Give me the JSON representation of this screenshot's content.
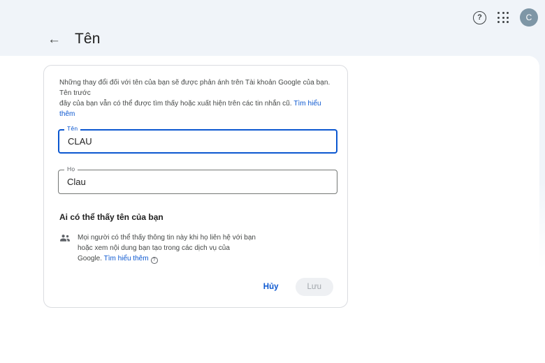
{
  "page": {
    "title": "Tên",
    "back_glyph": "←"
  },
  "topbar": {
    "help_glyph": "?",
    "avatar_letter": "C"
  },
  "card": {
    "description": {
      "line1": "Những thay đổi đối với tên của bạn sẽ được phản ánh trên Tài khoản Google của bạn. Tên trước",
      "line2": "đây của bạn vẫn có thể được tìm thấy hoặc xuất hiện trên các tin nhắn cũ. ",
      "link": "Tìm hiểu thêm"
    },
    "fields": [
      {
        "label": "Tên",
        "value": "CLAU"
      },
      {
        "label": "Họ",
        "value": "Clau"
      }
    ],
    "visibility": {
      "heading": "Ai có thể thấy tên của bạn",
      "line1": "Mọi người có thể thấy thông tin này khi họ liên hệ với bạn",
      "line2": "hoặc xem nội dung bạn tạo trong các dịch vụ của",
      "line3_prefix": "Google. ",
      "link": "Tìm hiểu thêm",
      "help_glyph": "?"
    },
    "actions": {
      "cancel": "Hủy",
      "save": "Lưu"
    }
  },
  "colors": {
    "accent": "#0b57d0",
    "header_bg": "#f0f4f9",
    "avatar_bg": "#7e96a6",
    "card_border": "#dadce0",
    "save_disabled_bg": "#eef0f3",
    "save_disabled_text": "#a1a6ab"
  }
}
